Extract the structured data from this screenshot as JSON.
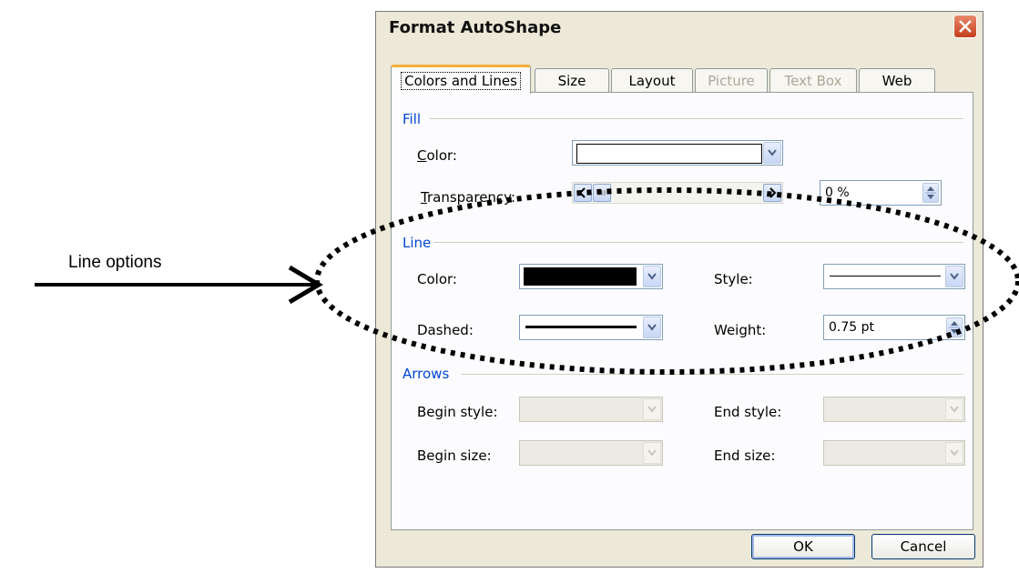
{
  "annotation": {
    "text": "Line options"
  },
  "dialog": {
    "title": "Format AutoShape",
    "tabs": [
      {
        "label": "Colors and Lines",
        "state": "active"
      },
      {
        "label": "Size",
        "state": "enabled"
      },
      {
        "label": "Layout",
        "state": "enabled"
      },
      {
        "label": "Picture",
        "state": "disabled"
      },
      {
        "label": "Text Box",
        "state": "disabled"
      },
      {
        "label": "Web",
        "state": "enabled"
      }
    ],
    "fill": {
      "header": "Fill",
      "color_label": "Color:",
      "color_value": "#ffffff",
      "transparency_label": "Transparency:",
      "transparency_value": "0 %"
    },
    "line": {
      "header": "Line",
      "color_label": "Color:",
      "color_value": "#000000",
      "dashed_label": "Dashed:",
      "style_label": "Style:",
      "weight_label": "Weight:",
      "weight_value": "0.75 pt"
    },
    "arrows": {
      "header": "Arrows",
      "begin_style_label": "Begin style:",
      "begin_size_label": "Begin size:",
      "end_style_label": "End style:",
      "end_size_label": "End size:"
    },
    "buttons": {
      "ok": "OK",
      "cancel": "Cancel"
    }
  },
  "colors": {
    "group_header": "#0046d5",
    "accent_tab": "#f3b03d",
    "close": "#c4401c"
  }
}
